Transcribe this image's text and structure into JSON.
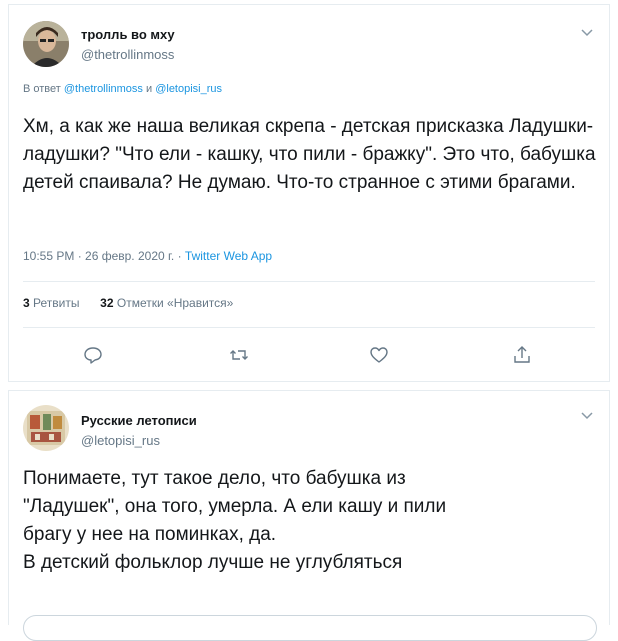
{
  "tweet1": {
    "author_name": "тролль во мху",
    "author_handle": "@thetrollinmoss",
    "reply_prefix": "В ответ",
    "reply_user1": "@thetrollinmoss",
    "reply_and": "и",
    "reply_user2": "@letopisi_rus",
    "text": "Хм, а как же наша великая скрепа - детская присказка Ладушки-ладушки? \"Что ели - кашку, что пили - бражку\". Это что, бабушка детей спаивала? Не думаю. Что-то странное с этими брагами.",
    "timestamp": "10:55 PM · 26 февр. 2020 г. ·",
    "source": "Twitter Web App",
    "retweets_count": "3",
    "retweets_label": "Ретвиты",
    "likes_count": "32",
    "likes_label": "Отметки «Нравится»",
    "actions": [
      "reply-icon",
      "retweet-icon",
      "like-icon",
      "share-icon"
    ]
  },
  "tweet2": {
    "author_name": "Русские летописи",
    "author_handle": "@letopisi_rus",
    "text_lines": [
      "Понимаете, тут такое дело, что бабушка из",
      "\"Ладушек\", она того, умерла. А ели кашу и пили",
      "брагу у нее на поминках, да.",
      "В детский фольклор лучше не углубляться"
    ]
  },
  "colors": {
    "text": "#14171a",
    "secondary": "#657786",
    "link": "#1b95e0",
    "border": "#e6ecf0"
  }
}
